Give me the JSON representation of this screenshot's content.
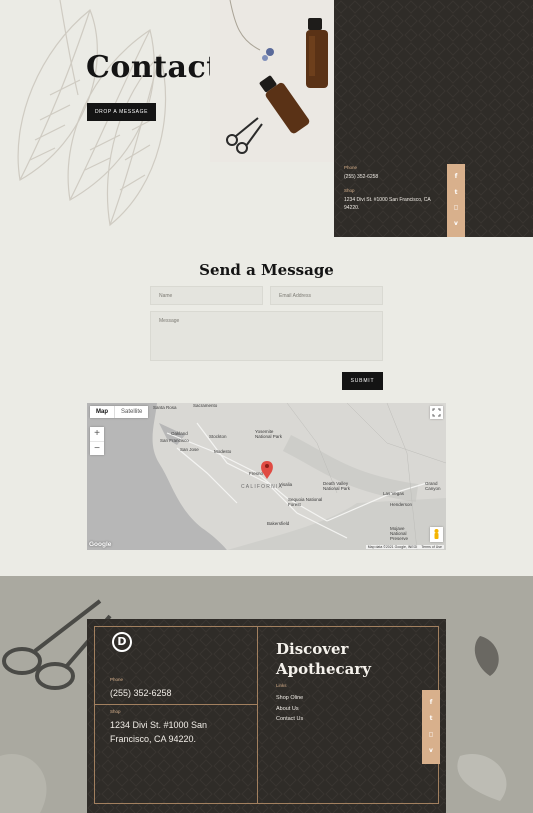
{
  "hero": {
    "title": "Contact Us",
    "cta_label": "DROP A MESSAGE",
    "phone_label": "Phone",
    "phone": "(255) 352-6258",
    "shop_label": "Shop",
    "shop_address": "1234 Divi St. #1000 San Francisco, CA 94220."
  },
  "social_icons": [
    {
      "name": "facebook-icon",
      "glyph": "f"
    },
    {
      "name": "twitter-icon",
      "glyph": "t"
    },
    {
      "name": "instagram-icon",
      "glyph": "◻"
    },
    {
      "name": "vimeo-icon",
      "glyph": "v"
    }
  ],
  "form": {
    "title": "Send a Message",
    "name_placeholder": "Name",
    "email_placeholder": "Email Address",
    "message_placeholder": "Message",
    "submit_label": "SUBMIT"
  },
  "map": {
    "type_map": "Map",
    "type_satellite": "Satellite",
    "zoom_in": "+",
    "zoom_out": "−",
    "state_label": "CALIFORNIA",
    "places": [
      "Santa Rosa",
      "Sacramento",
      "Oakland",
      "San Francisco",
      "San Jose",
      "Stockton",
      "Modesto",
      "Yosemite National Park",
      "Fresno",
      "Visalia",
      "Bakersfield",
      "Las Vegas",
      "Death Valley National Park",
      "Sequoia National Forest",
      "Mojave National Preserve",
      "Henderson",
      "Grand Canyon"
    ],
    "google": "Google",
    "credits": "Map data ©2021 Google, INEGI",
    "terms": "Terms of Use"
  },
  "footer": {
    "logo_letter": "D",
    "phone_label": "Phone",
    "phone": "(255) 352-6258",
    "shop_label": "Shop",
    "shop_address_line1": "1234 Divi St. #1000 San",
    "shop_address_line2": "Francisco, CA 94220.",
    "heading_line1": "Discover",
    "heading_line2": "Apothecary",
    "links_label": "Links",
    "links": [
      "Shop Oline",
      "About Us",
      "Contact Us"
    ]
  },
  "colors": {
    "accent_tan": "#d8b08c",
    "dark_panel": "#2f2c28",
    "page_bg": "#ebebe5",
    "button_black": "#141414",
    "map_pin": "#e04b43"
  }
}
